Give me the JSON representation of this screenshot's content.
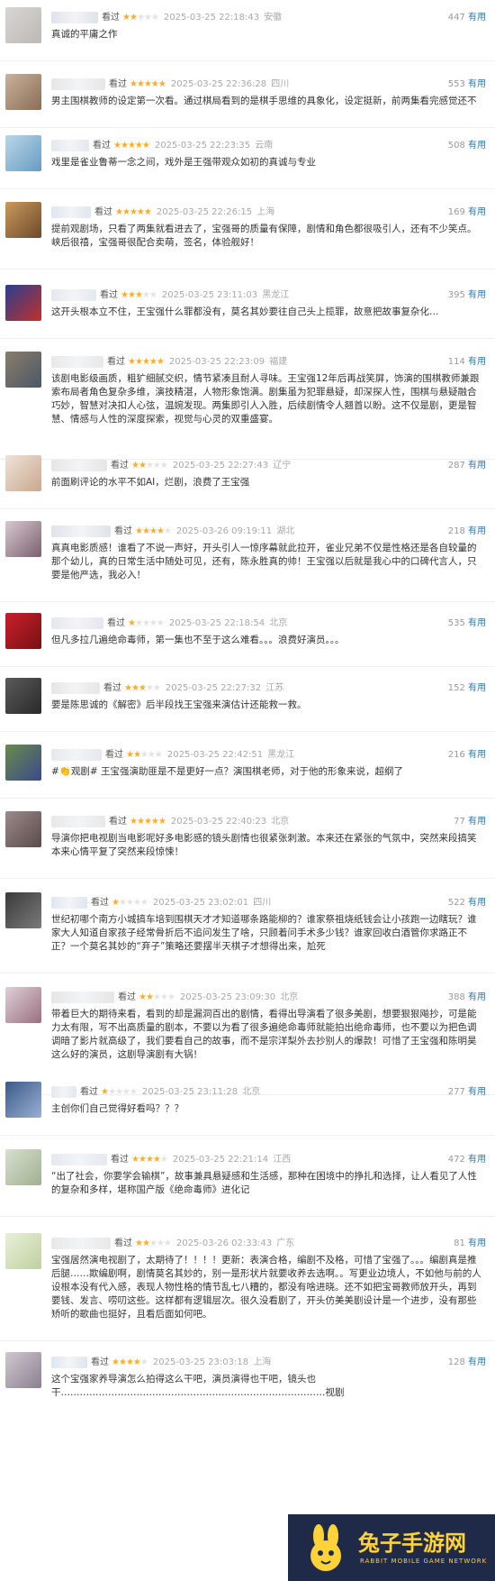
{
  "comments": [
    {
      "status": "看过",
      "rating": 2,
      "time": "2025-03-25 22:18:43",
      "location": "安徽",
      "count": "447",
      "useful": "有用",
      "text": "真诚的平庸之作",
      "avatar": [
        "#d8d6d4",
        "#bdb8b6"
      ],
      "blur": "#dfe3ea"
    },
    {
      "status": "看过",
      "rating": 5,
      "time": "2025-03-25 22:36:28",
      "location": "四川",
      "count": "553",
      "useful": "有用",
      "text": "男主围棋教师的设定第一次看。通过棋局看到的是棋手思维的具象化，设定挺新，前两集看完感觉还不错",
      "avatar": [
        "#c8b39d",
        "#8a6d55"
      ],
      "blur": "#e6e6e6"
    },
    {
      "status": "看过",
      "rating": 5,
      "time": "2025-03-25 22:23:35",
      "location": "云南",
      "count": "508",
      "useful": "有用",
      "text": "戏里是雀业鲁蒂一念之间，戏外是王强带观众如初的真诚与专业",
      "avatar": [
        "#b8d8ea",
        "#6a9ac0"
      ],
      "blur": "#e3e8ef"
    },
    {
      "status": "看过",
      "rating": 5,
      "time": "2025-03-25 22:26:15",
      "location": "上海",
      "count": "169",
      "useful": "有用",
      "text": "提前观剧场，只看了两集就看进去了，宝强哥的质量有保障，剧情和角色都很吸引人，还有不少笑点。峡后很禧，宝强哥很配合卖萌，签名，体验舰好！",
      "avatar": [
        "#c99a5e",
        "#6e4a2b"
      ],
      "blur": "#dfe6f0"
    },
    {
      "status": "看过",
      "rating": 3,
      "time": "2025-03-25 23:11:03",
      "location": "黑龙江",
      "count": "395",
      "useful": "有用",
      "text": "这开头根本立不住，王宝强什么罪都没有，莫名其妙要往自己头上揽罪，故意把故事复杂化…",
      "avatar": [
        "#2a3f8f",
        "#c0302a"
      ],
      "blur": "#e5e8ee"
    },
    {
      "status": "看过",
      "rating": 5,
      "time": "2025-03-25 22:23:09",
      "location": "福建",
      "count": "114",
      "useful": "有用",
      "text": "该剧电影级画质，粗犷细腻交织，情节紧凑且耐人寻味。王宝强12年后再战笑屏，饰演的围棋教师兼跟索布局者角色复杂多维，演技精湛，人物形象饱满。剧集虽为犯罪悬疑，却深探人性，围棋与悬疑融合巧妙，智慧对决扣人心弦，温婉发现。两集即引人入胜，后续剧情令人翘首以盼。这不仅是剧，更是智慧、情感与人性的深度探索，视觉与心灵的双重盛宴。",
      "avatar": [
        "#8a7d6b",
        "#4a5866"
      ],
      "blur": "#e8e8e8"
    },
    {
      "status": "看过",
      "rating": 2,
      "time": "2025-03-25 22:27:43",
      "location": "辽宁",
      "count": "287",
      "useful": "有用",
      "text": "前面刷评论的水平不如AI，烂剧，浪费了王宝强",
      "avatar": [
        "#efe3d8",
        "#c9a88e"
      ],
      "blur": "#e6e6e6"
    },
    {
      "status": "看过",
      "rating": 4,
      "time": "2025-03-26 09:19:11",
      "location": "湖北",
      "count": "218",
      "useful": "有用",
      "text": "真真电影质感！谁看了不说一声好，开头引人一惊序幕就此拉开，雀业兄弟不仅是性格还是各自较量的那个幼儿，真的日常生活中随处可见，还有，陈永胜真的帅！王宝强以后就是我心中的口碑代言人，只要是他严选，我必入！",
      "avatar": [
        "#d7c9cf",
        "#7a6070"
      ],
      "blur": "#dfe3ea"
    },
    {
      "status": "看过",
      "rating": 1,
      "time": "2025-03-25 22:18:54",
      "location": "北京",
      "count": "535",
      "useful": "有用",
      "text": "但凡多拉几遍绝命毒师，第一集也不至于这么难看。。。浪费好演员。。。",
      "avatar": [
        "#c8202a",
        "#7a1015"
      ],
      "blur": "#e3e8ef"
    },
    {
      "status": "看过",
      "rating": 3,
      "time": "2025-03-25 22:27:32",
      "location": "江苏",
      "count": "152",
      "useful": "有用",
      "text": "要是陈思诚的《解密》后半段找王宝强来演估计还能救一救。",
      "avatar": [
        "#5a5a5a",
        "#2a2a2a"
      ],
      "blur": "#e6e6e6"
    },
    {
      "status": "看过",
      "rating": 2,
      "time": "2025-03-25 22:42:51",
      "location": "黑龙江",
      "count": "216",
      "useful": "有用",
      "text": "#👏观剧# 王宝强演助匪是不是更好一点？演围棋老师，对于他的形象来说，超纲了",
      "avatar": [
        "#6a8a4a",
        "#3a4a8a"
      ],
      "blur": "#e5e8ee"
    },
    {
      "status": "看过",
      "rating": 5,
      "time": "2025-03-25 22:40:23",
      "location": "北京",
      "count": "77",
      "useful": "有用",
      "text": "导演你把电视剧当电影呢好多电影感的镜头剧情也很紧张刺激。本来还在紧张的气氛中，突然来段搞笑本来心情平复了突然来段惊悚！",
      "avatar": [
        "#9a8a8a",
        "#5a4a4a"
      ],
      "blur": "#e8e8e8"
    },
    {
      "status": "看过",
      "rating": 1,
      "time": "2025-03-25 23:02:01",
      "location": "四川",
      "count": "522",
      "useful": "有用",
      "text": "世纪初哪个南方小城搞车培到围棋天才才知道哪条路能柳的？谁家祭祖烧纸钱会让小孩跑一边瞎玩？谁家大人知道自家孩子经常骨折后不追问发生了啥，只顾着问手术多少钱？谁家回收白酒管你求路正不正？一个莫名其妙的“弃子”策略还要摆半天棋子才想得出来，尬死",
      "avatar": [
        "#3a3a3a",
        "#7a7a7a"
      ],
      "blur": "#dfe6f0"
    },
    {
      "status": "看过",
      "rating": 2,
      "time": "2025-03-25 23:09:30",
      "location": "北京",
      "count": "388",
      "useful": "有用",
      "text": "带着巨大的期待来看，看到的却是漏洞百出的剧情，看得出导演看了很多美剧，想要狠狠飚抄，可是能力太有限，写不出高质量的剧本，不要以为看了很多遍绝命毒师就能拍出绝命毒师，也不要以为把色调调暗了影片就高级了，我们要看自己的故事，而不是宗洋梨外去抄别人的爆款！可惜了王宝强和陈明昊这么好的演员，这剧导演剧有大锅！",
      "avatar": [
        "#e0d0d8",
        "#9a7080"
      ],
      "blur": "#e6e6e6"
    },
    {
      "status": "看过",
      "rating": 1,
      "time": "2025-03-25 23:11:28",
      "location": "北京",
      "count": "277",
      "useful": "有用",
      "text": "主创你们自己觉得好看吗？？？",
      "avatar": [
        "#3a5a8a",
        "#9ab0d0"
      ],
      "blur": "#e3e8ef"
    },
    {
      "status": "看过",
      "rating": 4,
      "time": "2025-03-25 22:21:14",
      "location": "江西",
      "count": "472",
      "useful": "有用",
      "text": "“出了社会，你要学会输棋”，故事兼具悬疑感和生活感，那种在困境中的挣扎和选择，让人看见了人性的复杂和多样，堪称国产版《绝命毒师》进化记",
      "avatar": [
        "#d8e0d0",
        "#a0b090"
      ],
      "blur": "#e5e8ee"
    },
    {
      "status": "看过",
      "rating": 2,
      "time": "2025-03-26 02:33:43",
      "location": "广东",
      "count": "81",
      "useful": "有用",
      "text": "宝强居然演电视剧了，太期待了！！！！更新：表演合格，编剧不及格，可惜了宝强了。。。编剧真是推后腿……欺编剧啊，剧情莫名其妙的，别一是形状片就要收养去选啊。。写更业边境人，不如他与前的人设根本没有代入感，表现人物性格的情节乱七八糟的，都没有啥进晓。还不如把宝哥教师放开头，再到要钱、发言、唠叨这些。这样都有逻辑层次。很久没看剧了，开头仿美美剧设计是一个进步，没有那些矫听的歌曲也挺好，且看后面如何吧。",
      "avatar": [
        "#e8f0d8",
        "#c0d0a0"
      ],
      "blur": "#e8e8e8"
    },
    {
      "status": "看过",
      "rating": 4,
      "time": "2025-03-25 23:03:18",
      "location": "上海",
      "count": "128",
      "useful": "有用",
      "text": "这个宝强家养导演怎么拍得这么干吧，演员演得也干吧，镜头也干…………………………………………………………………………视剧",
      "avatar": [
        "#d0c8d0",
        "#8a8090"
      ],
      "blur": "#dfe6f0"
    }
  ],
  "logo": {
    "title": "兔子手游网",
    "subtitle": "RABBIT MOBILE GAME NETWORK"
  },
  "colors": {
    "star": "#ffac2d",
    "link": "#3377aa",
    "logo_bg": "#1f2a49",
    "logo_fg": "#ffd238"
  }
}
